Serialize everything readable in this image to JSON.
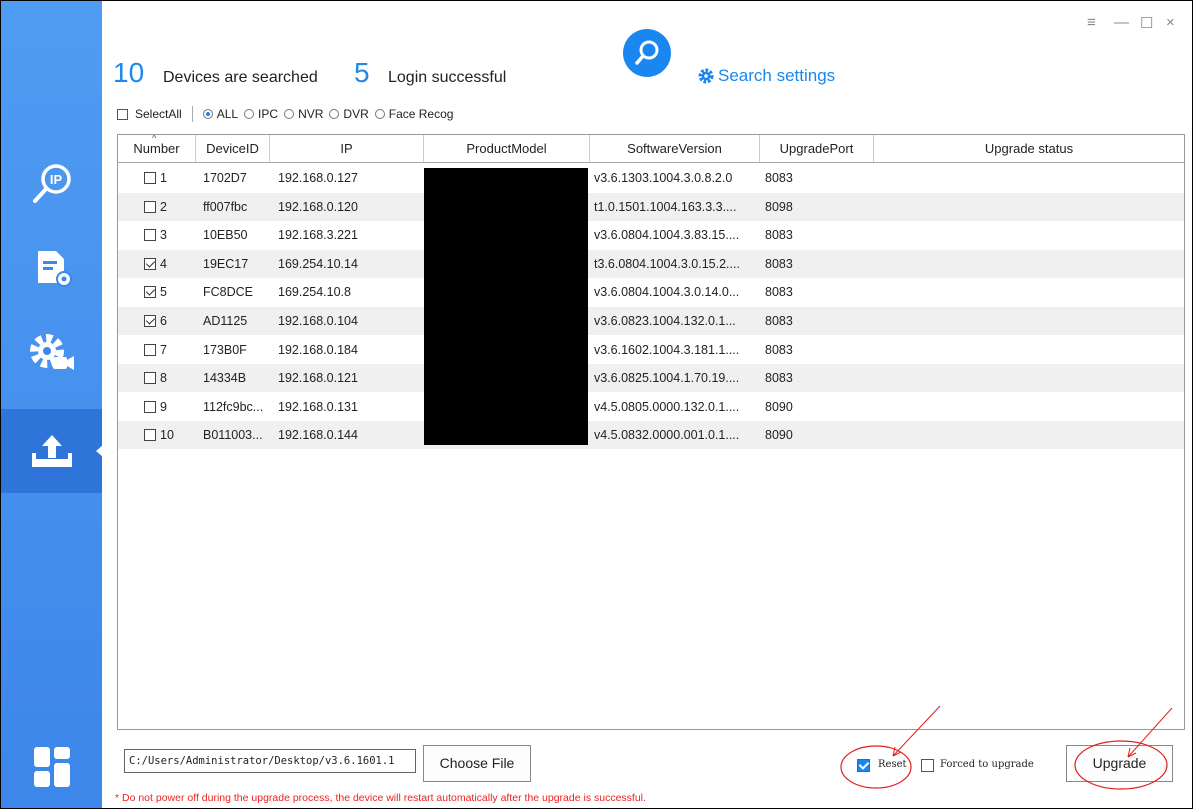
{
  "window": {
    "menu_glyph": "≡",
    "minimize_glyph": "—",
    "maximize_glyph": "☐",
    "close_glyph": "×"
  },
  "header": {
    "searched_count": "10",
    "searched_label": "Devices are searched",
    "login_count": "5",
    "login_label": "Login successful",
    "search_settings_label": "Search settings"
  },
  "sidebar": {
    "items": [
      {
        "icon": "ip-search-icon"
      },
      {
        "icon": "document-settings-icon"
      },
      {
        "icon": "camera-settings-icon"
      },
      {
        "icon": "upload-icon",
        "active": true
      },
      {
        "icon": "app-logo-icon"
      }
    ]
  },
  "filter": {
    "select_all_label": "SelectAll",
    "options": [
      "ALL",
      "IPC",
      "NVR",
      "DVR",
      "Face Recog"
    ],
    "selected": "ALL"
  },
  "table": {
    "columns": [
      "Number",
      "DeviceID",
      "IP",
      "ProductModel",
      "SoftwareVersion",
      "UpgradePort",
      "Upgrade status"
    ],
    "rows": [
      {
        "num": "1",
        "checked": false,
        "id": "1702D7",
        "ip": "192.168.0.127",
        "model": "",
        "version": "v3.6.1303.1004.3.0.8.2.0",
        "port": "8083",
        "status": ""
      },
      {
        "num": "2",
        "checked": false,
        "id": "ff007fbc",
        "ip": "192.168.0.120",
        "model": "",
        "version": "t1.0.1501.1004.163.3.3....",
        "port": "8098",
        "status": ""
      },
      {
        "num": "3",
        "checked": false,
        "id": "10EB50",
        "ip": "192.168.3.221",
        "model": "",
        "version": "v3.6.0804.1004.3.83.15....",
        "port": "8083",
        "status": ""
      },
      {
        "num": "4",
        "checked": true,
        "id": "19EC17",
        "ip": "169.254.10.14",
        "model": "",
        "version": "t3.6.0804.1004.3.0.15.2....",
        "port": "8083",
        "status": ""
      },
      {
        "num": "5",
        "checked": true,
        "id": "FC8DCE",
        "ip": "169.254.10.8",
        "model": "",
        "version": "v3.6.0804.1004.3.0.14.0...",
        "port": "8083",
        "status": ""
      },
      {
        "num": "6",
        "checked": true,
        "id": "AD1125",
        "ip": "192.168.0.104",
        "model": "",
        "version": "v3.6.0823.1004.132.0.1...",
        "port": "8083",
        "status": ""
      },
      {
        "num": "7",
        "checked": false,
        "id": "173B0F",
        "ip": "192.168.0.184",
        "model": "",
        "version": "v3.6.1602.1004.3.181.1....",
        "port": "8083",
        "status": ""
      },
      {
        "num": "8",
        "checked": false,
        "id": "14334B",
        "ip": "192.168.0.121",
        "model": "",
        "version": "v3.6.0825.1004.1.70.19....",
        "port": "8083",
        "status": ""
      },
      {
        "num": "9",
        "checked": false,
        "id": "112fc9bc...",
        "ip": "192.168.0.131",
        "model": "",
        "version": "v4.5.0805.0000.132.0.1....",
        "port": "8090",
        "status": ""
      },
      {
        "num": "10",
        "checked": false,
        "id": "B011003...",
        "ip": "192.168.0.144",
        "model": "",
        "version": "v4.5.0832.0000.001.0.1....",
        "port": "8090",
        "status": ""
      }
    ]
  },
  "bottom": {
    "file_path": "C:/Users/Administrator/Desktop/v3.6.1601.1",
    "choose_file_label": "Choose File",
    "reset_label": "Reset",
    "reset_checked": true,
    "forced_label": "Forced to upgrade",
    "forced_checked": false,
    "upgrade_label": "Upgrade",
    "warning": "* Do not power off during the upgrade process, the device will restart automatically after the upgrade is successful."
  },
  "colors": {
    "accent": "#1a87f0",
    "sidebar": "#3d86ea",
    "warning": "#e22222",
    "annotation": "#e02020"
  }
}
